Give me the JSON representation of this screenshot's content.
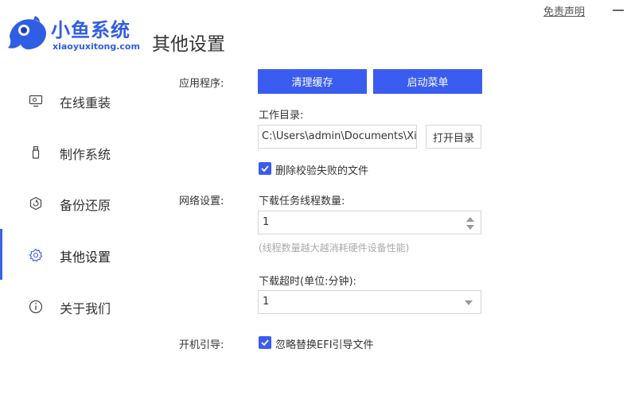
{
  "app": {
    "name": "小鱼系统",
    "domain": "xiaoyuxitong.com",
    "page_title": "其他设置",
    "disclaimer_link": "免责声明",
    "brand_color": "#2f5de3",
    "accent_color": "#3a5cf0"
  },
  "sidebar": {
    "items": [
      {
        "label": "在线重装",
        "icon": "monitor-icon"
      },
      {
        "label": "制作系统",
        "icon": "usb-icon"
      },
      {
        "label": "备份还原",
        "icon": "backup-icon"
      },
      {
        "label": "其他设置",
        "icon": "gear-icon",
        "active": true
      },
      {
        "label": "关于我们",
        "icon": "info-icon"
      }
    ]
  },
  "settings": {
    "application": {
      "label": "应用程序:",
      "clear_cache_button": "清理缓存",
      "startup_menu_button": "启动菜单",
      "work_dir_label": "工作目录:",
      "work_dir_value": "C:\\Users\\admin\\Documents\\Xia",
      "open_dir_button": "打开目录",
      "delete_failed_files_label": "删除校验失败的文件",
      "delete_failed_files_checked": true
    },
    "network": {
      "label": "网络设置:",
      "threads_label": "下载任务线程数量:",
      "threads_value": "1",
      "threads_hint": "(线程数量越大越消耗硬件设备性能)",
      "timeout_label": "下载超时(单位:分钟):",
      "timeout_value": "1"
    },
    "boot": {
      "label": "开机引导:",
      "ignore_efi_label": "忽略替换EFI引导文件",
      "ignore_efi_checked": true
    }
  }
}
